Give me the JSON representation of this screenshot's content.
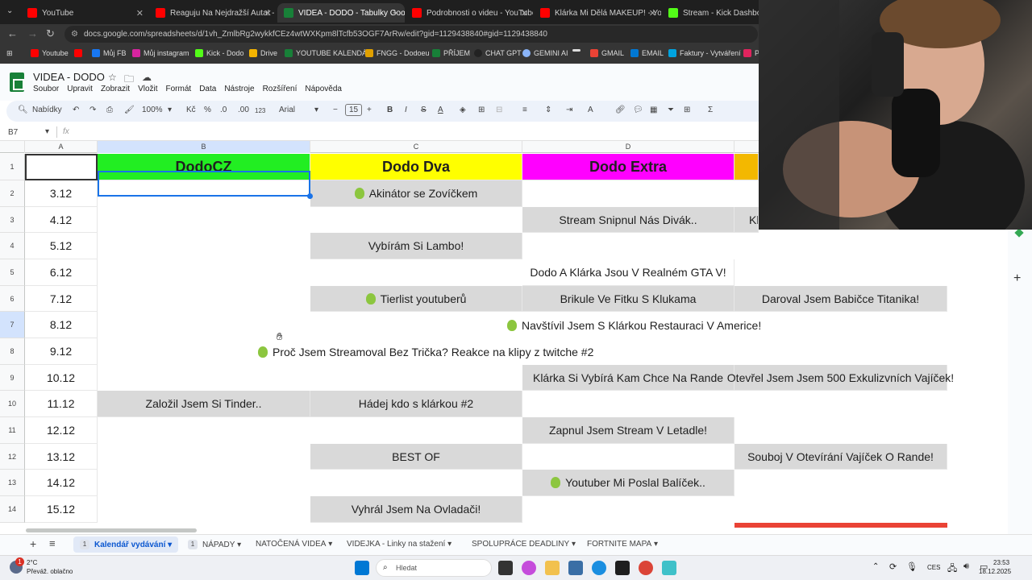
{
  "browser": {
    "tabs": [
      {
        "title": "YouTube",
        "color": "#ff0000"
      },
      {
        "title": "Reaguju Na Nejdražší Auta! - Yo",
        "color": "#ff0000"
      },
      {
        "title": "VIDEA - DODO - Tabulky Goog",
        "color": "#188038"
      },
      {
        "title": "Podrobnosti o videu - YouTube",
        "color": "#ff0000"
      },
      {
        "title": "Klárka Mi Dělá MAKEUP! - YouT",
        "color": "#ff0000"
      },
      {
        "title": "Stream - Kick Dashboard",
        "color": "#53fc18"
      }
    ],
    "url": "docs.google.com/spreadsheets/d/1vh_ZmlbRg2wykkfCEz4wtWXKpm8lTcfb53OGF7ArRw/edit?gid=1129438840#gid=1129438840",
    "bookmarks": [
      "Youtube",
      "Můj FB",
      "Můj instagram",
      "Kick - Dodo",
      "Drive",
      "YOUTUBE KALENDÁŘ",
      "FNGG - Dodoeu",
      "PŘÍJEM",
      "CHAT GPT",
      "GEMINI AI",
      "",
      "GMAIL",
      "EMAIL",
      "Faktury - Vytváření",
      "P"
    ]
  },
  "sheet": {
    "title": "VIDEA - DODO",
    "menu": [
      "Soubor",
      "Upravit",
      "Zobrazit",
      "Vložit",
      "Formát",
      "Data",
      "Nástroje",
      "Rozšíření",
      "Nápověda"
    ],
    "toolbar": {
      "search": "Nabídky",
      "zoom": "100%",
      "currency": "Kč",
      "percent": "%",
      "dec_minus": ".0",
      "dec_plus": ".00",
      "num": "123",
      "font": "Arial",
      "fontsize": "15",
      "sum": "Σ"
    },
    "namebox": "B7",
    "fx": "fx",
    "columns": [
      "A",
      "B",
      "C",
      "D"
    ],
    "row_numbers": [
      "1",
      "2",
      "3",
      "4",
      "5",
      "6",
      "7",
      "8",
      "9",
      "10",
      "11",
      "12",
      "13",
      "14"
    ],
    "headers": {
      "b": "DodoCZ",
      "c": "Dodo Dva",
      "d": "Dodo Extra"
    },
    "header_colors": {
      "b": "#22ee22",
      "c": "#ffff00",
      "d": "#ff00ff",
      "e": "#f3b800"
    },
    "dates": [
      "3.12",
      "4.12",
      "5.12",
      "6.12",
      "7.12",
      "8.12",
      "9.12",
      "10.12",
      "11.12",
      "12.12",
      "13.12",
      "14.12",
      "15.12"
    ],
    "cells": {
      "r2c": "Akinátor se Zovíčkem",
      "r3d": "Stream Snipnul Nás Divák..",
      "r3e": "Kl",
      "r4c": "Vybírám Si Lambo!",
      "r5d": "Dodo A Klárka Jsou V Realném GTA V!",
      "r6c": "Tierlist youtuberů",
      "r6d": "Brikule Ve Fitku S Klukama",
      "r6e": "Daroval Jsem Babičce Titanika!",
      "r7": "Navštívil Jsem S Klárkou Restauraci V Americe!",
      "r8": "Proč Jsem Streamoval Bez Trička? Reakce na klipy z twitche #2",
      "r9d": "Klárka Si Vybírá Kam Chce Na Rande",
      "r9e": "Otevřel Jsem Jsem 500 Exkulizvních Vajíček!",
      "r10b": "Založil Jsem Si Tinder..",
      "r10c": "Hádej kdo s klárkou #2",
      "r11d": "Zapnul Jsem Stream V Letadle!",
      "r12c": "BEST OF",
      "r12e": "Souboj V Otevírání Vajíček O Rande!",
      "r13d": "Youtuber Mi Poslal Balíček..",
      "r14c": "Vyhrál Jsem Na Ovladači!"
    },
    "sheet_tabs": [
      {
        "label": "Kalendář vydávání",
        "badge": "1",
        "active": true
      },
      {
        "label": "NÁPADY",
        "badge": "1"
      },
      {
        "label": "NATOČENÁ VIDEA"
      },
      {
        "label": "VIDEJKA - Linky na stažení"
      },
      {
        "label": "SPOLUPRÁCE DEADLINY"
      },
      {
        "label": "FORTNITE MAPA"
      }
    ]
  },
  "taskbar": {
    "weather_temp": "2°C",
    "weather_desc": "Převáž. oblačno",
    "weather_badge": "1",
    "search": "Hledat",
    "lang": "CES",
    "time": "23:53",
    "date": "18.12.2025"
  }
}
